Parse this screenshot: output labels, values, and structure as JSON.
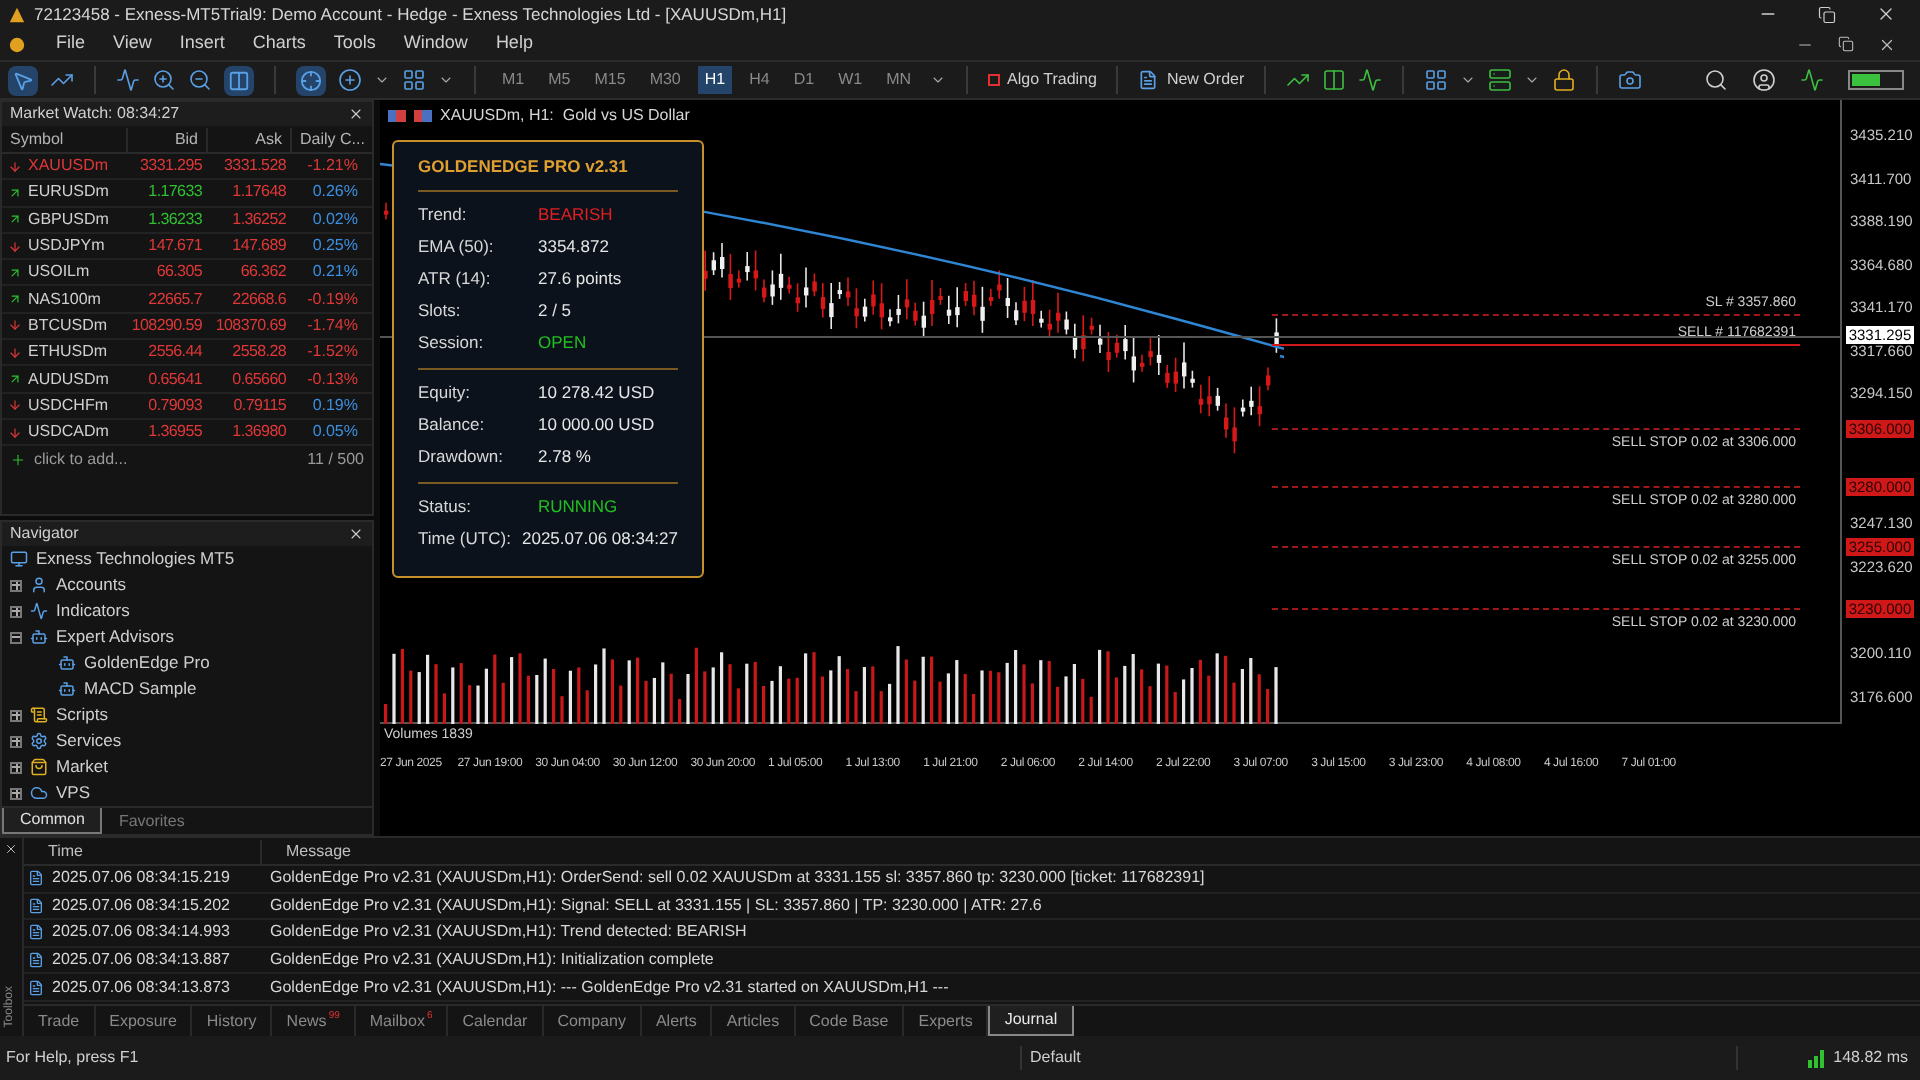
{
  "window": {
    "title": "72123458 - Exness-MT5Trial9: Demo Account - Hedge - Exness Technologies Ltd - [XAUUSDm,H1]"
  },
  "menu": [
    "File",
    "View",
    "Insert",
    "Charts",
    "Tools",
    "Window",
    "Help"
  ],
  "toolbar": {
    "timeframes": [
      {
        "label": "M1",
        "selected": false
      },
      {
        "label": "M5",
        "selected": false
      },
      {
        "label": "M15",
        "selected": false
      },
      {
        "label": "M30",
        "selected": false
      },
      {
        "label": "H1",
        "selected": true
      },
      {
        "label": "H4",
        "selected": false
      },
      {
        "label": "D1",
        "selected": false
      },
      {
        "label": "W1",
        "selected": false
      },
      {
        "label": "MN",
        "selected": false
      }
    ],
    "algo_trading": "Algo Trading",
    "new_order": "New Order"
  },
  "market_watch": {
    "title": "Market Watch: 08:34:27",
    "columns": [
      "Symbol",
      "Bid",
      "Ask",
      "Daily C..."
    ],
    "rows": [
      {
        "symbol": "XAUUSDm",
        "bid": "3331.295",
        "ask": "3331.528",
        "change": "-1.21%",
        "up": false,
        "highlighted": true,
        "bid_up": false,
        "change_negative": true
      },
      {
        "symbol": "EURUSDm",
        "bid": "1.17633",
        "ask": "1.17648",
        "change": "0.26%",
        "up": true,
        "highlighted": false,
        "bid_up": true,
        "change_negative": false
      },
      {
        "symbol": "GBPUSDm",
        "bid": "1.36233",
        "ask": "1.36252",
        "change": "0.02%",
        "up": true,
        "highlighted": false,
        "bid_up": true,
        "change_negative": false
      },
      {
        "symbol": "USDJPYm",
        "bid": "147.671",
        "ask": "147.689",
        "change": "0.25%",
        "up": false,
        "highlighted": false,
        "bid_up": false,
        "change_negative": false
      },
      {
        "symbol": "USOILm",
        "bid": "66.305",
        "ask": "66.362",
        "change": "0.21%",
        "up": true,
        "highlighted": false,
        "bid_up": false,
        "change_negative": false
      },
      {
        "symbol": "NAS100m",
        "bid": "22665.7",
        "ask": "22668.6",
        "change": "-0.19%",
        "up": true,
        "highlighted": false,
        "bid_up": false,
        "change_negative": true
      },
      {
        "symbol": "BTCUSDm",
        "bid": "108290.59",
        "ask": "108370.69",
        "change": "-1.74%",
        "up": false,
        "highlighted": false,
        "bid_up": false,
        "change_negative": true
      },
      {
        "symbol": "ETHUSDm",
        "bid": "2556.44",
        "ask": "2558.28",
        "change": "-1.52%",
        "up": false,
        "highlighted": false,
        "bid_up": false,
        "change_negative": true
      },
      {
        "symbol": "AUDUSDm",
        "bid": "0.65641",
        "ask": "0.65660",
        "change": "-0.13%",
        "up": true,
        "highlighted": false,
        "bid_up": false,
        "change_negative": true
      },
      {
        "symbol": "USDCHFm",
        "bid": "0.79093",
        "ask": "0.79115",
        "change": "0.19%",
        "up": false,
        "highlighted": false,
        "bid_up": false,
        "change_negative": false
      },
      {
        "symbol": "USDCADm",
        "bid": "1.36955",
        "ask": "1.36980",
        "change": "0.05%",
        "up": false,
        "highlighted": false,
        "bid_up": false,
        "change_negative": false
      }
    ],
    "add_hint": "click to add...",
    "count": "11 / 500"
  },
  "navigator": {
    "title": "Navigator",
    "root": "Exness Technologies MT5",
    "items": [
      {
        "label": "Accounts",
        "kind": "accounts",
        "expanded": false
      },
      {
        "label": "Indicators",
        "kind": "indicators",
        "expanded": false
      },
      {
        "label": "Expert Advisors",
        "kind": "experts",
        "expanded": true,
        "children": [
          {
            "label": "GoldenEdge Pro"
          },
          {
            "label": "MACD Sample"
          }
        ]
      },
      {
        "label": "Scripts",
        "kind": "scripts",
        "expanded": false
      },
      {
        "label": "Services",
        "kind": "services",
        "expanded": false
      },
      {
        "label": "Market",
        "kind": "market",
        "expanded": false
      },
      {
        "label": "VPS",
        "kind": "vps",
        "expanded": false
      }
    ],
    "tabs": [
      {
        "label": "Common",
        "selected": true
      },
      {
        "label": "Favorites",
        "selected": false
      }
    ]
  },
  "chart": {
    "header": "XAUUSDm, H1:  Gold vs US Dollar",
    "panel": {
      "title": "GOLDENEDGE PRO v2.31",
      "sections": [
        [
          {
            "label": "Trend:",
            "value": "BEARISH",
            "color": "#e02020"
          },
          {
            "label": "EMA (50):",
            "value": "3354.872",
            "color": "#e6e6e6"
          },
          {
            "label": "ATR (14):",
            "value": "27.6 points",
            "color": "#e6e6e6"
          },
          {
            "label": "Slots:",
            "value": "2 / 5",
            "color": "#e6e6e6"
          },
          {
            "label": "Session:",
            "value": "OPEN",
            "color": "#20c020"
          }
        ],
        [
          {
            "label": "Equity:",
            "value": "10 278.42 USD",
            "color": "#e6e6e6"
          },
          {
            "label": "Balance:",
            "value": "10 000.00 USD",
            "color": "#e6e6e6"
          },
          {
            "label": "Drawdown:",
            "value": "2.78 %",
            "color": "#e6e6e6"
          }
        ],
        [
          {
            "label": "Status:",
            "value": "RUNNING",
            "color": "#20c020"
          },
          {
            "label": "Time (UTC):",
            "value": "2025.07.06 08:34:27",
            "color": "#e6e6e6"
          }
        ]
      ]
    },
    "price_axis": [
      "3435.210",
      "3411.700",
      "3388.190",
      "3364.680",
      "3341.170",
      "3317.660",
      "3294.150",
      "3247.130",
      "3223.620",
      "3200.110",
      "3176.600"
    ],
    "bid_tag": "3331.295",
    "orders": [
      {
        "kind": "sl",
        "label": "SL # 3357.860"
      },
      {
        "kind": "position",
        "label": "SELL # 117682391"
      },
      {
        "kind": "pending",
        "label": "SELL STOP 0.02 at 3306.000",
        "tag": "3306.000"
      },
      {
        "kind": "pending",
        "label": "SELL STOP 0.02 at 3280.000",
        "tag": "3280.000"
      },
      {
        "kind": "pending",
        "label": "SELL STOP 0.02 at 3255.000",
        "tag": "3255.000"
      },
      {
        "kind": "pending",
        "label": "SELL STOP 0.02 at 3230.000",
        "tag": "3230.000"
      }
    ],
    "volumes_label": "Volumes 1839",
    "time_axis": [
      "27 Jun 2025",
      "27 Jun 19:00",
      "30 Jun 04:00",
      "30 Jun 12:00",
      "30 Jun 20:00",
      "1 Jul 05:00",
      "1 Jul 13:00",
      "1 Jul 21:00",
      "2 Jul 06:00",
      "2 Jul 14:00",
      "2 Jul 22:00",
      "3 Jul 07:00",
      "3 Jul 15:00",
      "3 Jul 23:00",
      "4 Jul 08:00",
      "4 Jul 16:00",
      "7 Jul 01:00"
    ]
  },
  "toolbox": {
    "side_label": "Toolbox",
    "columns": [
      "Time",
      "Message"
    ],
    "rows": [
      {
        "time": "2025.07.06 08:34:15.219",
        "message": "GoldenEdge Pro v2.31 (XAUUSDm,H1): OrderSend: sell 0.02 XAUUSDm at 3331.155 sl: 3357.860 tp: 3230.000 [ticket: 117682391]"
      },
      {
        "time": "2025.07.06 08:34:15.202",
        "message": "GoldenEdge Pro v2.31 (XAUUSDm,H1): Signal: SELL at 3331.155 | SL: 3357.860 | TP: 3230.000 | ATR: 27.6"
      },
      {
        "time": "2025.07.06 08:34:14.993",
        "message": "GoldenEdge Pro v2.31 (XAUUSDm,H1): Trend detected: BEARISH"
      },
      {
        "time": "2025.07.06 08:34:13.887",
        "message": "GoldenEdge Pro v2.31 (XAUUSDm,H1): Initialization complete"
      },
      {
        "time": "2025.07.06 08:34:13.873",
        "message": "GoldenEdge Pro v2.31 (XAUUSDm,H1): --- GoldenEdge Pro v2.31 started on XAUUSDm,H1 ---"
      }
    ],
    "tabs": [
      {
        "label": "Trade",
        "selected": false
      },
      {
        "label": "Exposure",
        "selected": false
      },
      {
        "label": "History",
        "selected": false
      },
      {
        "label": "News",
        "badge": "99",
        "selected": false
      },
      {
        "label": "Mailbox",
        "badge": "6",
        "selected": false
      },
      {
        "label": "Calendar",
        "selected": false
      },
      {
        "label": "Company",
        "selected": false
      },
      {
        "label": "Alerts",
        "selected": false
      },
      {
        "label": "Articles",
        "selected": false
      },
      {
        "label": "Code Base",
        "selected": false
      },
      {
        "label": "Experts",
        "selected": false
      },
      {
        "label": "Journal",
        "selected": true
      }
    ]
  },
  "status_bar": {
    "help": "For Help, press F1",
    "profile": "Default",
    "ping": "148.82 ms"
  }
}
